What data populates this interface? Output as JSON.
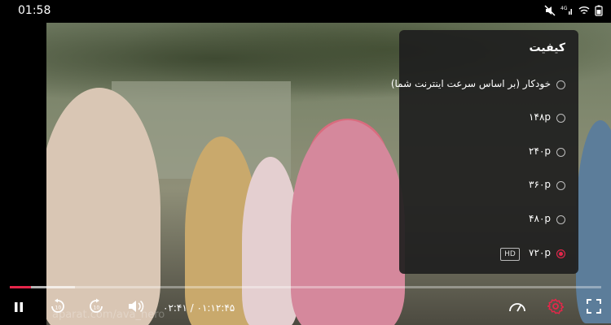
{
  "status_bar": {
    "time": "01:58",
    "icons": [
      "mute-icon",
      "signal-4g-icon",
      "wifi-icon",
      "battery-icon"
    ]
  },
  "video": {
    "watermark": "aparat.com/ava_hero"
  },
  "quality_menu": {
    "title": "کیفیت",
    "options": [
      {
        "label": "خودکار  (بر اساس سرعت اینترنت شما)",
        "selected": false
      },
      {
        "label": "۱۴۸p",
        "selected": false
      },
      {
        "label": "۲۴۰p",
        "selected": false
      },
      {
        "label": "۳۶۰p",
        "selected": false
      },
      {
        "label": "۴۸۰p",
        "selected": false
      },
      {
        "label": "۷۲۰p",
        "selected": true,
        "badge": "HD"
      }
    ]
  },
  "player": {
    "time_readout": "۰۲:۴۱ / ۰۱:۱۲:۴۵",
    "progress_fraction": 0.036,
    "buffer_fraction": 0.11,
    "accent_color": "#e6264a",
    "buttons": [
      "pause-icon",
      "rewind-10-icon",
      "forward-10-icon",
      "volume-icon",
      "speed-icon",
      "settings-icon",
      "fullscreen-icon"
    ]
  }
}
